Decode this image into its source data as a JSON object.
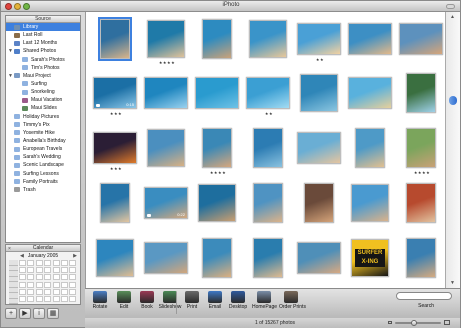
{
  "window": {
    "title": "iPhoto"
  },
  "source": {
    "header": "Source",
    "items": [
      {
        "label": "Library",
        "icon": "library-icon",
        "color": "#6e8fb3",
        "selected": true,
        "indent": 0,
        "disclosure": ""
      },
      {
        "label": "Last Roll",
        "icon": "film-roll-icon",
        "color": "#8a6d4a",
        "selected": false,
        "indent": 0,
        "disclosure": ""
      },
      {
        "label": "Last 12 Months",
        "icon": "calendar-icon",
        "color": "#5b83c7",
        "selected": false,
        "indent": 0,
        "disclosure": ""
      },
      {
        "label": "Shared Photos",
        "icon": "shared-folder-icon",
        "color": "#4f7fc9",
        "selected": false,
        "indent": 0,
        "disclosure": "▼"
      },
      {
        "label": "Sarah's Photos",
        "icon": "album-icon",
        "color": "#8fb2e0",
        "selected": false,
        "indent": 1,
        "disclosure": ""
      },
      {
        "label": "Tim's Photos",
        "icon": "album-icon",
        "color": "#8fb2e0",
        "selected": false,
        "indent": 1,
        "disclosure": ""
      },
      {
        "label": "Maui Project",
        "icon": "folder-icon",
        "color": "#7a9ac4",
        "selected": false,
        "indent": 0,
        "disclosure": "▼"
      },
      {
        "label": "Surfing",
        "icon": "album-icon",
        "color": "#8fb2e0",
        "selected": false,
        "indent": 1,
        "disclosure": ""
      },
      {
        "label": "Snorkeling",
        "icon": "album-icon",
        "color": "#8fb2e0",
        "selected": false,
        "indent": 1,
        "disclosure": ""
      },
      {
        "label": "Maui Vacation",
        "icon": "book-icon",
        "color": "#9b5a8a",
        "selected": false,
        "indent": 1,
        "disclosure": ""
      },
      {
        "label": "Maui Slides",
        "icon": "slideshow-icon",
        "color": "#5c8a5a",
        "selected": false,
        "indent": 1,
        "disclosure": ""
      },
      {
        "label": "Holiday Pictures",
        "icon": "album-icon",
        "color": "#8fb2e0",
        "selected": false,
        "indent": 0,
        "disclosure": ""
      },
      {
        "label": "Timmy's Pix",
        "icon": "album-icon",
        "color": "#8fb2e0",
        "selected": false,
        "indent": 0,
        "disclosure": ""
      },
      {
        "label": "Yosemite Hike",
        "icon": "album-icon",
        "color": "#8fb2e0",
        "selected": false,
        "indent": 0,
        "disclosure": ""
      },
      {
        "label": "Anabella's Birthday",
        "icon": "album-icon",
        "color": "#8fb2e0",
        "selected": false,
        "indent": 0,
        "disclosure": ""
      },
      {
        "label": "European Travels",
        "icon": "album-icon",
        "color": "#8fb2e0",
        "selected": false,
        "indent": 0,
        "disclosure": ""
      },
      {
        "label": "Sarah's Wedding",
        "icon": "album-icon",
        "color": "#8fb2e0",
        "selected": false,
        "indent": 0,
        "disclosure": ""
      },
      {
        "label": "Scenic Landscape",
        "icon": "album-icon",
        "color": "#8fb2e0",
        "selected": false,
        "indent": 0,
        "disclosure": ""
      },
      {
        "label": "Surfing Lessons",
        "icon": "album-icon",
        "color": "#8fb2e0",
        "selected": false,
        "indent": 0,
        "disclosure": ""
      },
      {
        "label": "Family Portraits",
        "icon": "album-icon",
        "color": "#8fb2e0",
        "selected": false,
        "indent": 0,
        "disclosure": ""
      },
      {
        "label": "Trash",
        "icon": "trash-icon",
        "color": "#9a9a9a",
        "selected": false,
        "indent": 0,
        "disclosure": ""
      }
    ]
  },
  "calendar": {
    "header": "Calendar",
    "month": "January 2005",
    "prev": "◀",
    "next": "▶",
    "close": "×"
  },
  "bottom_buttons": [
    {
      "name": "add-album-button",
      "glyph": "+"
    },
    {
      "name": "play-slideshow-button",
      "glyph": "▶"
    },
    {
      "name": "info-button",
      "glyph": "i"
    },
    {
      "name": "calendar-toggle-button",
      "glyph": "▦"
    }
  ],
  "photos": [
    {
      "row": 0,
      "col": 0,
      "shape": "portrait",
      "c1": "#2f6f9f",
      "c2": "#d8b48a",
      "stars": "",
      "video": false,
      "selected": true
    },
    {
      "row": 0,
      "col": 1,
      "shape": "square",
      "c1": "#1f7aa8",
      "c2": "#e0c39a",
      "stars": "★★★★",
      "video": false,
      "selected": false
    },
    {
      "row": 0,
      "col": 2,
      "shape": "portrait",
      "c1": "#2d8bc0",
      "c2": "#caa27a",
      "stars": "",
      "video": false,
      "selected": false
    },
    {
      "row": 0,
      "col": 3,
      "shape": "square",
      "c1": "#3a94c9",
      "c2": "#e8c89a",
      "stars": "",
      "video": false,
      "selected": false
    },
    {
      "row": 0,
      "col": 4,
      "shape": "landscape",
      "c1": "#4aa0d6",
      "c2": "#f2d2a2",
      "stars": "★★",
      "video": false,
      "selected": false
    },
    {
      "row": 0,
      "col": 5,
      "shape": "landscape",
      "c1": "#3d8fc4",
      "c2": "#e3b98a",
      "stars": "",
      "video": false,
      "selected": false
    },
    {
      "row": 0,
      "col": 6,
      "shape": "landscape",
      "c1": "#5d91bd",
      "c2": "#d6a57a",
      "stars": "",
      "video": false,
      "selected": false
    },
    {
      "row": 1,
      "col": 0,
      "shape": "landscape",
      "c1": "#1b6fa5",
      "c2": "#8cc7e8",
      "stars": "★★★",
      "video": true,
      "dur": "0:15",
      "selected": false
    },
    {
      "row": 1,
      "col": 1,
      "shape": "landscape",
      "c1": "#1f86bf",
      "c2": "#9ad2ef",
      "stars": "",
      "video": false,
      "selected": false
    },
    {
      "row": 1,
      "col": 2,
      "shape": "landscape",
      "c1": "#2a9bcf",
      "c2": "#6fc2e6",
      "stars": "",
      "video": false,
      "selected": false
    },
    {
      "row": 1,
      "col": 3,
      "shape": "landscape",
      "c1": "#3b9fd3",
      "c2": "#a3dcf3",
      "stars": "★★",
      "video": false,
      "selected": false
    },
    {
      "row": 1,
      "col": 4,
      "shape": "square",
      "c1": "#2f86b8",
      "c2": "#8bc6e0",
      "stars": "",
      "video": false,
      "selected": false
    },
    {
      "row": 1,
      "col": 5,
      "shape": "landscape",
      "c1": "#59b1dd",
      "c2": "#e7d09c",
      "stars": "",
      "video": false,
      "selected": false
    },
    {
      "row": 1,
      "col": 6,
      "shape": "portrait",
      "c1": "#3a6f40",
      "c2": "#9fd1e9",
      "stars": "",
      "video": false,
      "selected": false
    },
    {
      "row": 2,
      "col": 0,
      "shape": "landscape",
      "c1": "#2b1e35",
      "c2": "#e07b2a",
      "stars": "★★★",
      "video": false,
      "selected": false
    },
    {
      "row": 2,
      "col": 1,
      "shape": "square",
      "c1": "#4b8fbf",
      "c2": "#d8b184",
      "stars": "",
      "video": false,
      "selected": false
    },
    {
      "row": 2,
      "col": 2,
      "shape": "portrait",
      "c1": "#3a88b6",
      "c2": "#d6a77d",
      "stars": "★★★★",
      "video": false,
      "selected": false
    },
    {
      "row": 2,
      "col": 3,
      "shape": "portrait",
      "c1": "#2c7cb3",
      "c2": "#8ac2df",
      "stars": "",
      "video": false,
      "selected": false
    },
    {
      "row": 2,
      "col": 4,
      "shape": "landscape",
      "c1": "#6aaed4",
      "c2": "#e5c5a0",
      "stars": "",
      "video": false,
      "selected": false
    },
    {
      "row": 2,
      "col": 5,
      "shape": "portrait",
      "c1": "#4e9ac7",
      "c2": "#e2c090",
      "stars": "",
      "video": false,
      "selected": false
    },
    {
      "row": 2,
      "col": 6,
      "shape": "portrait",
      "c1": "#7ba55c",
      "c2": "#c9a176",
      "stars": "★★★★",
      "video": false,
      "selected": false
    },
    {
      "row": 3,
      "col": 0,
      "shape": "portrait",
      "c1": "#2774a8",
      "c2": "#e3c6a0",
      "stars": "",
      "video": false,
      "selected": false
    },
    {
      "row": 3,
      "col": 1,
      "shape": "landscape",
      "c1": "#3a8dc0",
      "c2": "#d4a87e",
      "stars": "",
      "video": true,
      "dur": "0:22",
      "selected": false
    },
    {
      "row": 3,
      "col": 2,
      "shape": "square",
      "c1": "#1e6e9e",
      "c2": "#c99e70",
      "stars": "",
      "video": false,
      "selected": false
    },
    {
      "row": 3,
      "col": 3,
      "shape": "portrait",
      "c1": "#4f93c2",
      "c2": "#dcb38a",
      "stars": "",
      "video": false,
      "selected": false
    },
    {
      "row": 3,
      "col": 4,
      "shape": "portrait",
      "c1": "#6a4a3a",
      "c2": "#d5a47a",
      "stars": "",
      "video": false,
      "selected": false
    },
    {
      "row": 3,
      "col": 5,
      "shape": "square",
      "c1": "#4a9ad0",
      "c2": "#d9b28b",
      "stars": "",
      "video": false,
      "selected": false
    },
    {
      "row": 3,
      "col": 6,
      "shape": "portrait",
      "c1": "#b74a2e",
      "c2": "#e2c3a0",
      "stars": "",
      "video": false,
      "selected": false
    },
    {
      "row": 4,
      "col": 0,
      "shape": "square",
      "c1": "#2d86be",
      "c2": "#e0bd92",
      "stars": "",
      "video": false,
      "selected": false
    },
    {
      "row": 4,
      "col": 1,
      "shape": "landscape",
      "c1": "#5a98c3",
      "c2": "#d2a67c",
      "stars": "",
      "video": false,
      "selected": false
    },
    {
      "row": 4,
      "col": 2,
      "shape": "portrait",
      "c1": "#3c8bbb",
      "c2": "#dcb080",
      "stars": "",
      "video": false,
      "selected": false
    },
    {
      "row": 4,
      "col": 3,
      "shape": "portrait",
      "c1": "#2a7dae",
      "c2": "#dfbb90",
      "stars": "",
      "video": false,
      "selected": false
    },
    {
      "row": 4,
      "col": 4,
      "shape": "landscape",
      "c1": "#4f8fb8",
      "c2": "#d8a982",
      "stars": "",
      "video": false,
      "selected": false
    },
    {
      "row": 4,
      "col": 5,
      "shape": "square",
      "c1": "#f0c020",
      "c2": "#151515",
      "stars": "",
      "video": false,
      "selected": false,
      "sign": "SURFER X-ING"
    },
    {
      "row": 4,
      "col": 6,
      "shape": "portrait",
      "c1": "#3a7fb1",
      "c2": "#d6ab80",
      "stars": "",
      "video": false,
      "selected": false
    }
  ],
  "toolbar": {
    "tools": [
      {
        "name": "rotate-button",
        "icon": "rotate-icon",
        "label": "Rotate",
        "color": "#4b7fc6"
      },
      {
        "name": "edit-button",
        "icon": "edit-icon",
        "label": "Edit",
        "color": "#5a8f5a"
      },
      {
        "name": "book-button",
        "icon": "book-icon",
        "label": "Book",
        "color": "#9b3a55"
      },
      {
        "name": "slideshow-button",
        "icon": "slideshow-icon",
        "label": "Slideshow",
        "color": "#4a8a55"
      },
      {
        "name": "print-button",
        "icon": "printer-icon",
        "label": "Print",
        "color": "#6a6a6a"
      },
      {
        "name": "email-button",
        "icon": "email-icon",
        "label": "Email",
        "color": "#3e78c6"
      },
      {
        "name": "desktop-button",
        "icon": "desktop-icon",
        "label": "Desktop",
        "color": "#2f5a9e"
      },
      {
        "name": "homepage-button",
        "icon": "homepage-icon",
        "label": "HomePage",
        "color": "#7a8ea8"
      },
      {
        "name": "order-prints-button",
        "icon": "order-prints-icon",
        "label": "Order Prints",
        "color": "#7a6a5a"
      }
    ],
    "search_label": "Search",
    "search_placeholder": ""
  },
  "status": {
    "text": "1 of 15267 photos"
  }
}
